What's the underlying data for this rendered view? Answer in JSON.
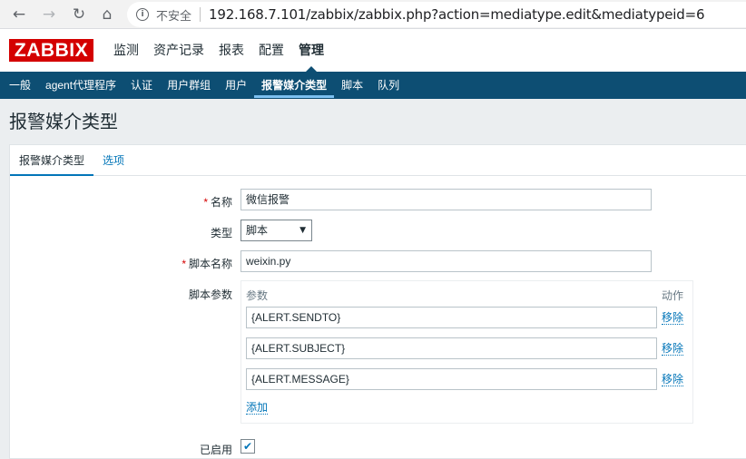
{
  "browser": {
    "back_icon": "←",
    "forward_icon": "→",
    "reload_icon": "↻",
    "home_icon": "⌂",
    "info_icon": "i",
    "security_label": "不安全",
    "url": "192.168.7.101/zabbix/zabbix.php?action=mediatype.edit&mediatypeid=6"
  },
  "logo": "ZABBIX",
  "main_nav": [
    "监测",
    "资产记录",
    "报表",
    "配置",
    "管理"
  ],
  "main_nav_active": "管理",
  "sub_nav": [
    "一般",
    "agent代理程序",
    "认证",
    "用户群组",
    "用户",
    "报警媒介类型",
    "脚本",
    "队列"
  ],
  "sub_nav_active": "报警媒介类型",
  "page_title": "报警媒介类型",
  "tabs": {
    "mediatype": "报警媒介类型",
    "options": "选项"
  },
  "form": {
    "required_mark": "*",
    "name_label": "名称",
    "name_value": "微信报警",
    "type_label": "类型",
    "type_value": "脚本",
    "type_arrow": "▼",
    "script_name_label": "脚本名称",
    "script_name_value": "weixin.py",
    "script_params_label": "脚本参数",
    "params_header": "参数",
    "actions_header": "动作",
    "params": [
      {
        "value": "{ALERT.SENDTO}",
        "remove": "移除"
      },
      {
        "value": "{ALERT.SUBJECT}",
        "remove": "移除"
      },
      {
        "value": "{ALERT.MESSAGE}",
        "remove": "移除"
      }
    ],
    "add_label": "添加",
    "enabled_label": "已启用",
    "enabled_checked": true,
    "check_mark": "✔"
  },
  "colors": {
    "brand": "#d40000",
    "nav_bg": "#0d4e73",
    "link": "#0275b8"
  }
}
